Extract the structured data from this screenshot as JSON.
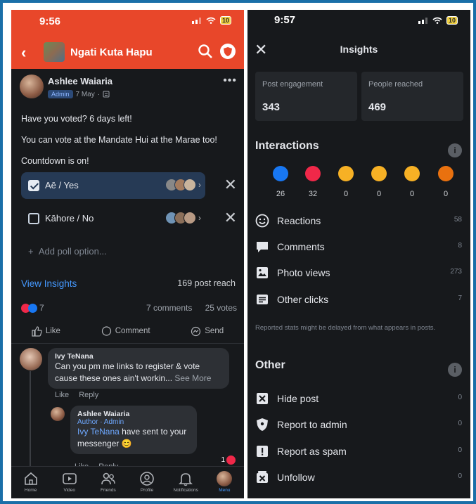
{
  "left": {
    "status": {
      "time": "9:56",
      "battery": "10"
    },
    "header": {
      "group_name": "Ngati Kuta Hapu"
    },
    "post": {
      "author": "Ashlee Waiaria",
      "role": "Admin",
      "date": "7 May",
      "lines": [
        "Have you voted? 6 days left!",
        "You can vote at the Mandate Hui at the Marae too!",
        "Countdown is on!"
      ],
      "poll_options": [
        {
          "label": "Aē / Yes",
          "checked": true
        },
        {
          "label": "Kāhore / No",
          "checked": false
        }
      ],
      "add_option": "Add poll option...",
      "view_insights": "View Insights",
      "post_reach": "169 post reach",
      "reaction_count": "7",
      "comments_count": "7 comments",
      "votes_count": "25 votes",
      "actions": [
        "Like",
        "Comment",
        "Send"
      ]
    },
    "comments": [
      {
        "name": "Ivy TeNana",
        "text": "Can you pm me links to register & vote cause these ones ain't workin...",
        "see_more": "See More",
        "actions": [
          "Like",
          "Reply"
        ]
      },
      {
        "name": "Ashlee Waiaria",
        "tags": "Author · Admin",
        "mention": "Ivy TeNana",
        "text": " have sent to your messenger 😊",
        "actions": [
          "Like",
          "Reply"
        ]
      }
    ],
    "notif_count": "1",
    "tabs": [
      "Home",
      "Video",
      "Friends",
      "Profile",
      "Notifications",
      "Menu"
    ]
  },
  "right": {
    "status": {
      "time": "9:57",
      "battery": "10"
    },
    "title": "Insights",
    "stats": [
      {
        "label": "Post engagement",
        "value": "343"
      },
      {
        "label": "People reached",
        "value": "469"
      }
    ],
    "interactions_title": "Interactions",
    "reactions": [
      {
        "icon": "like-icon",
        "count": "26",
        "color": "#1877f2"
      },
      {
        "icon": "love-icon",
        "count": "32",
        "color": "#f02849"
      },
      {
        "icon": "haha-icon",
        "count": "0",
        "color": "#f7b125"
      },
      {
        "icon": "wow-icon",
        "count": "0",
        "color": "#f7b125"
      },
      {
        "icon": "sad-icon",
        "count": "0",
        "color": "#f7b125"
      },
      {
        "icon": "angry-icon",
        "count": "0",
        "color": "#e9710f"
      }
    ],
    "interaction_rows": [
      {
        "icon": "smile-icon",
        "label": "Reactions",
        "value": "58"
      },
      {
        "icon": "comment-icon",
        "label": "Comments",
        "value": "8"
      },
      {
        "icon": "photo-icon",
        "label": "Photo views",
        "value": "273"
      },
      {
        "icon": "list-icon",
        "label": "Other clicks",
        "value": "7"
      }
    ],
    "note": "Reported stats might be delayed from what appears in posts.",
    "other_title": "Other",
    "other_rows": [
      {
        "icon": "hide-icon",
        "label": "Hide post",
        "value": "0"
      },
      {
        "icon": "shield-icon",
        "label": "Report to admin",
        "value": "0"
      },
      {
        "icon": "alert-icon",
        "label": "Report as spam",
        "value": "0"
      },
      {
        "icon": "unfollow-icon",
        "label": "Unfollow",
        "value": "0"
      }
    ]
  }
}
